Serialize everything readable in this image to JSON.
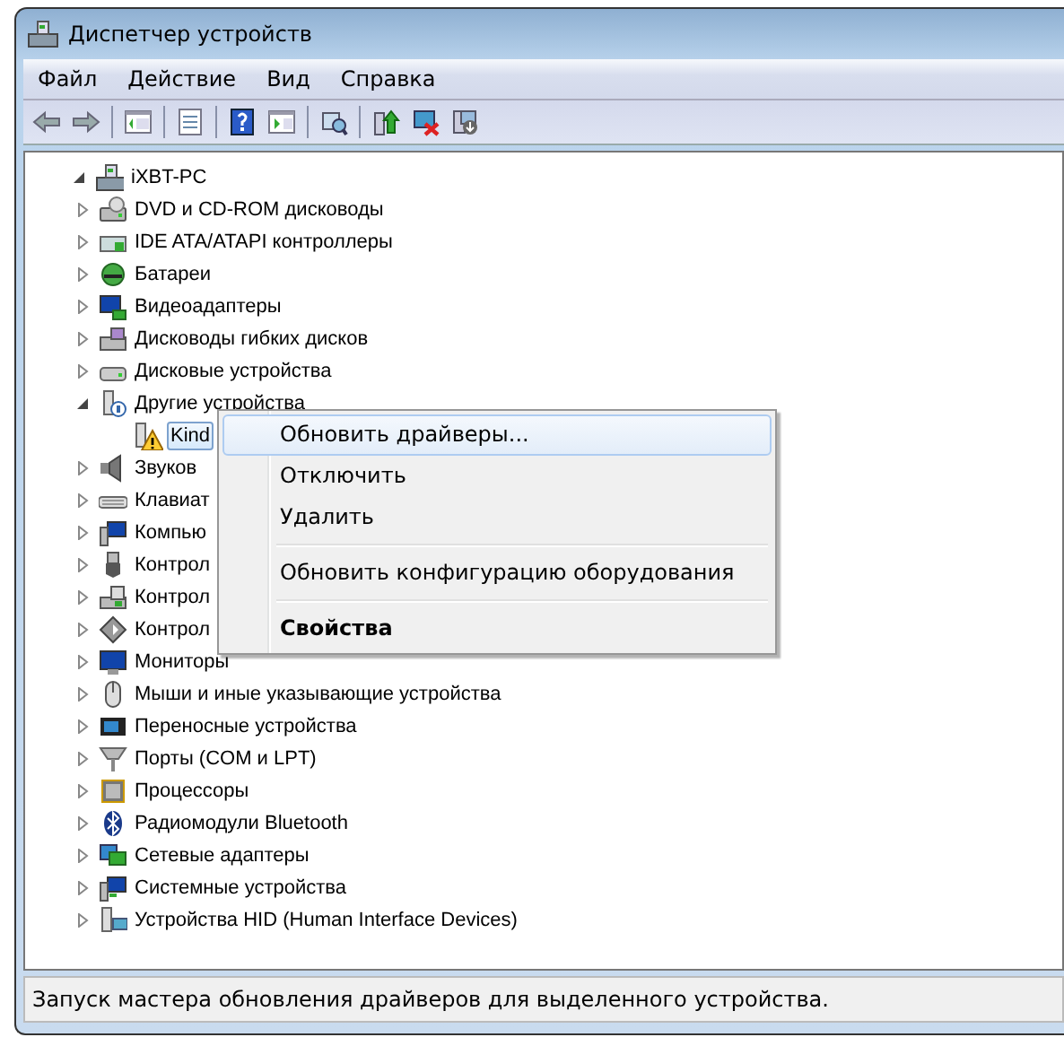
{
  "window": {
    "title": "Диспетчер устройств"
  },
  "menu_bar": [
    "Файл",
    "Действие",
    "Вид",
    "Справка"
  ],
  "tree": {
    "label": "iXBT-PC",
    "expanded": true,
    "selected": false,
    "children": [
      {
        "label": "DVD и CD-ROM дисководы",
        "expanded": false,
        "selected": false
      },
      {
        "label": "IDE ATA/ATAPI контроллеры",
        "expanded": false,
        "selected": false
      },
      {
        "label": "Батареи",
        "expanded": false,
        "selected": false
      },
      {
        "label": "Видеоадаптеры",
        "expanded": false,
        "selected": false
      },
      {
        "label": "Дисководы гибких дисков",
        "expanded": false,
        "selected": false
      },
      {
        "label": "Дисковые устройства",
        "expanded": false,
        "selected": false
      },
      {
        "label": "Другие устройства",
        "expanded": true,
        "selected": false,
        "children": [
          {
            "label": "Kind",
            "selected": true
          }
        ]
      },
      {
        "label": "Звуков",
        "expanded": false,
        "selected": false
      },
      {
        "label": "Клавиат",
        "expanded": false,
        "selected": false
      },
      {
        "label": "Компью",
        "expanded": false,
        "selected": false
      },
      {
        "label": "Контрол",
        "expanded": false,
        "selected": false
      },
      {
        "label": "Контрол",
        "expanded": false,
        "selected": false
      },
      {
        "label": "Контрол",
        "expanded": false,
        "selected": false
      },
      {
        "label": "Мониторы",
        "expanded": false,
        "selected": false
      },
      {
        "label": "Мыши и иные указывающие устройства",
        "expanded": false,
        "selected": false
      },
      {
        "label": "Переносные устройства",
        "expanded": false,
        "selected": false
      },
      {
        "label": "Порты (COM и LPT)",
        "expanded": false,
        "selected": false
      },
      {
        "label": "Процессоры",
        "expanded": false,
        "selected": false
      },
      {
        "label": "Радиомодули Bluetooth",
        "expanded": false,
        "selected": false
      },
      {
        "label": "Сетевые адаптеры",
        "expanded": false,
        "selected": false
      },
      {
        "label": "Системные устройства",
        "expanded": false,
        "selected": false
      },
      {
        "label": "Устройства HID (Human Interface Devices)",
        "expanded": false,
        "selected": false
      }
    ]
  },
  "context_menu": [
    {
      "kind": "item",
      "label": "Обновить драйверы...",
      "selected": true,
      "default": false
    },
    {
      "kind": "item",
      "label": "Отключить",
      "selected": false,
      "default": false
    },
    {
      "kind": "item",
      "label": "Удалить",
      "selected": false,
      "default": false
    },
    {
      "kind": "separator"
    },
    {
      "kind": "item",
      "label": "Обновить конфигурацию оборудования",
      "selected": false,
      "default": false
    },
    {
      "kind": "separator"
    },
    {
      "kind": "item",
      "label": "Свойства",
      "selected": false,
      "default": true
    }
  ],
  "status_bar": "Запуск мастера обновления драйверов для выделенного устройства."
}
